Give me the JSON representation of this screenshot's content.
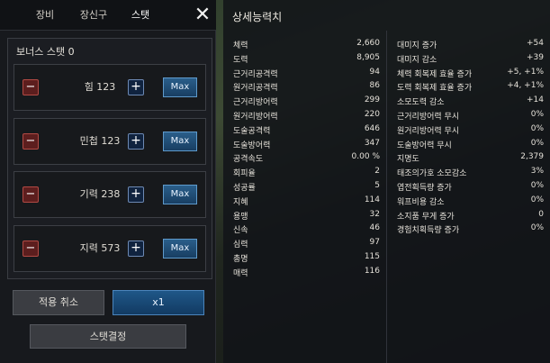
{
  "tabs": [
    {
      "label": "장비"
    },
    {
      "label": "장신구"
    },
    {
      "label": "스탯"
    }
  ],
  "close_symbol": "✕",
  "bonus": {
    "title": "보너스 스탯 0",
    "rows": [
      {
        "label": "힘 123",
        "minus": "−",
        "plus": "+",
        "max": "Max"
      },
      {
        "label": "민첩 123",
        "minus": "−",
        "plus": "+",
        "max": "Max"
      },
      {
        "label": "기력 238",
        "minus": "−",
        "plus": "+",
        "max": "Max"
      },
      {
        "label": "지력 573",
        "minus": "−",
        "plus": "+",
        "max": "Max"
      }
    ]
  },
  "actions": {
    "cancel": "적용 취소",
    "multiplier": "x1",
    "confirm": "스탯결정"
  },
  "detail": {
    "title": "상세능력치",
    "left": [
      {
        "k": "체력",
        "v": "2,660"
      },
      {
        "k": "도력",
        "v": "8,905"
      },
      {
        "k": "근거리공격력",
        "v": "94"
      },
      {
        "k": "원거리공격력",
        "v": "86"
      },
      {
        "k": "근거리방어력",
        "v": "299"
      },
      {
        "k": "원거리방어력",
        "v": "220"
      },
      {
        "k": "도술공격력",
        "v": "646"
      },
      {
        "k": "도술방어력",
        "v": "347"
      },
      {
        "k": "공격속도",
        "v": "0.00 %"
      },
      {
        "k": "회피율",
        "v": "2"
      },
      {
        "k": "성공률",
        "v": "5"
      },
      {
        "k": "지혜",
        "v": "114"
      },
      {
        "k": "용맹",
        "v": "32"
      },
      {
        "k": "신속",
        "v": "46"
      },
      {
        "k": "심력",
        "v": "97"
      },
      {
        "k": "총명",
        "v": "115"
      },
      {
        "k": "매력",
        "v": "116"
      }
    ],
    "right": [
      {
        "k": "대미지 증가",
        "v": "+54"
      },
      {
        "k": "대미지 감소",
        "v": "+39"
      },
      {
        "k": "체력 회복제 효율 증가",
        "v": "+5, +1%"
      },
      {
        "k": "도력 회복제 효율 증가",
        "v": "+4, +1%"
      },
      {
        "k": "소모도력 감소",
        "v": "+14"
      },
      {
        "k": "근거리방어력 무시",
        "v": "0%"
      },
      {
        "k": "원거리방어력 무시",
        "v": "0%"
      },
      {
        "k": "도술방어력 무시",
        "v": "0%"
      },
      {
        "k": "지명도",
        "v": "2,379"
      },
      {
        "k": "태조의가호 소모감소",
        "v": "3%"
      },
      {
        "k": "엽전획득량 증가",
        "v": "0%"
      },
      {
        "k": "워프비용 감소",
        "v": "0%"
      },
      {
        "k": "소지품 무게 증가",
        "v": "0"
      },
      {
        "k": "경험치획득량 증가",
        "v": "0%"
      }
    ]
  }
}
